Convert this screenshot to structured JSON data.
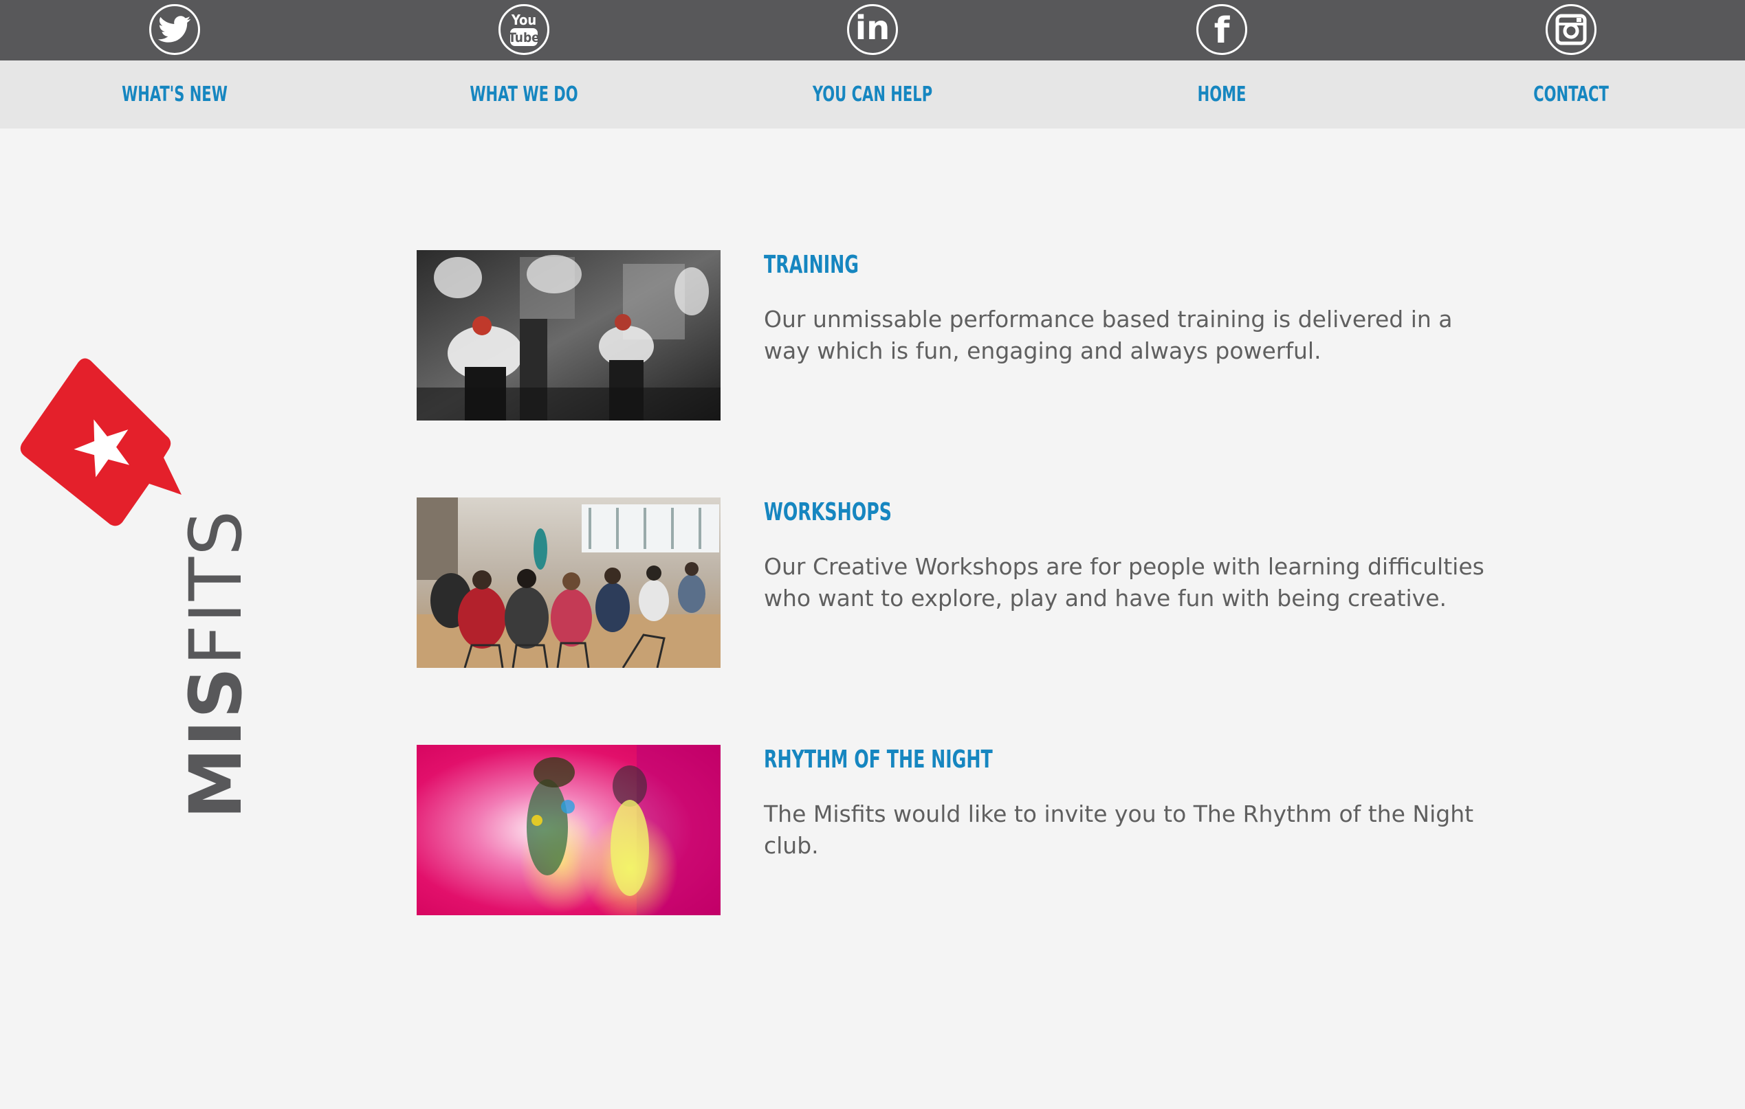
{
  "social": [
    {
      "name": "twitter",
      "icon": "twitter-icon"
    },
    {
      "name": "youtube",
      "icon": "youtube-icon",
      "label_top": "You",
      "label_bottom": "Tube"
    },
    {
      "name": "linkedin",
      "icon": "linkedin-icon",
      "label": "in"
    },
    {
      "name": "facebook",
      "icon": "facebook-icon",
      "label": "f"
    },
    {
      "name": "instagram",
      "icon": "instagram-icon"
    }
  ],
  "nav": {
    "whats_new": "WHAT'S NEW",
    "what_we_do": "WHAT WE DO",
    "you_can_help": "YOU CAN HELP",
    "home": "HOME",
    "contact": "CONTACT"
  },
  "logo": {
    "text_bold": "MIS",
    "text_light": "FITS",
    "colors": {
      "badge": "#e4202b",
      "text": "#58585a"
    }
  },
  "articles": [
    {
      "title": "TRAINING",
      "text": "Our unmissable performance based training is delivered in a way which is fun, engaging and always powerful."
    },
    {
      "title": "WORKSHOPS",
      "text": "Our Creative Workshops are for people with learning difficulties who want to explore, play and have fun with being creative."
    },
    {
      "title": "RHYTHM OF THE NIGHT",
      "text": "The Misfits would like to invite you to The Rhythm of the Night club."
    }
  ],
  "colors": {
    "top_bar": "#58585a",
    "nav_bar": "#e6e6e6",
    "accent": "#1686c0",
    "body_text": "#5f5f5f",
    "background": "#f4f4f4"
  }
}
